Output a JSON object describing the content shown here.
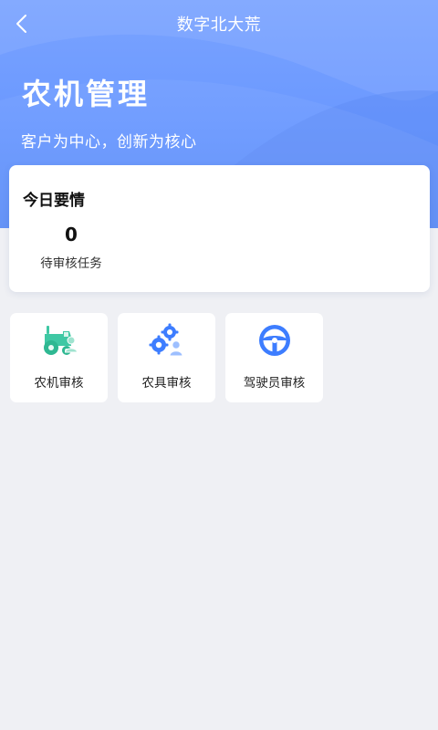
{
  "nav": {
    "back_icon": "chevron-left-icon",
    "title": "数字北大荒"
  },
  "hero": {
    "title": "农机管理",
    "subtitle": "客户为中心，创新为核心"
  },
  "today": {
    "title": "今日要情",
    "stats": [
      {
        "value": "0",
        "label": "待审核任务"
      }
    ]
  },
  "tiles": [
    {
      "label": "农机审核",
      "icon": "tractor-user-icon"
    },
    {
      "label": "农具审核",
      "icon": "gears-user-icon"
    },
    {
      "label": "驾驶员审核",
      "icon": "steering-wheel-icon"
    }
  ],
  "colors": {
    "hero_blue": "#6a98ff",
    "background": "#eff0f4",
    "tractor_green": "#3fc8a4",
    "icon_blue": "#3d7dff"
  }
}
